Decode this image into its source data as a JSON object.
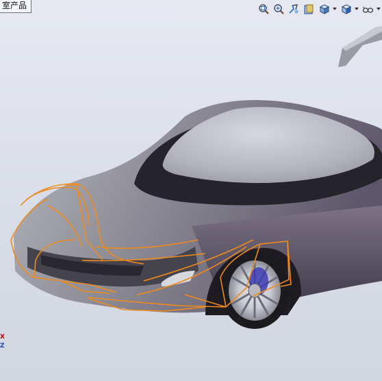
{
  "window": {
    "title_tab": "室产品"
  },
  "toolbar": {
    "buttons": [
      {
        "icon": "zoom-to-fit-icon"
      },
      {
        "icon": "zoom-to-area-icon"
      },
      {
        "icon": "previous-view-icon"
      },
      {
        "icon": "section-view-icon"
      },
      {
        "icon": "view-orientation-icon",
        "has_dropdown": true
      },
      {
        "icon": "display-style-icon",
        "has_dropdown": true
      },
      {
        "icon": "hide-show-items-icon",
        "has_dropdown": true
      }
    ]
  },
  "triad": {
    "x_label": "X",
    "z_label": "Z",
    "x_color": "#c00000",
    "z_color": "#1f3fbf"
  },
  "colors": {
    "background": "#dde1ea",
    "selection_highlight": "#f08a1c",
    "body_paint": "#6f6a78",
    "canopy": "#b9bbc3"
  }
}
